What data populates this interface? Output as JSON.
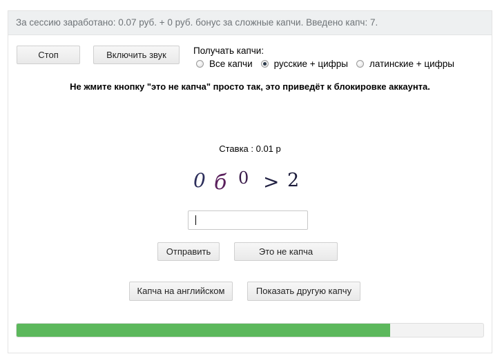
{
  "status": {
    "session_text": "За сессию заработано: 0.07 руб. + 0 руб. бонус за сложные капчи. Введено капч: 7."
  },
  "controls": {
    "stop_label": "Стоп",
    "sound_label": "Включить звук",
    "mode_label": "Получать капчи:",
    "modes": [
      {
        "label": "Все капчи",
        "checked": false
      },
      {
        "label": "русские + цифры",
        "checked": true
      },
      {
        "label": "латинские + цифры",
        "checked": false
      }
    ]
  },
  "warning_text": "Не жмите кнопку \"это не капча\" просто так, это приведёт к блокировке аккаунта.",
  "rate_text": "Ставка : 0.01 р",
  "captcha": {
    "glyphs": [
      "0",
      "б",
      "0",
      ">",
      "2"
    ],
    "colors": [
      "#2b2d5a",
      "#5a1f5c",
      "#3a1b4a",
      "#222244",
      "#1b1b3a"
    ]
  },
  "answer": {
    "value": "",
    "placeholder": ""
  },
  "actions": {
    "send_label": "Отправить",
    "not_captcha_label": "Это не капча",
    "english_label": "Капча на английском",
    "other_label": "Показать другую капчу"
  },
  "progress": {
    "fraction": 0.8,
    "color": "#5cb85c"
  }
}
